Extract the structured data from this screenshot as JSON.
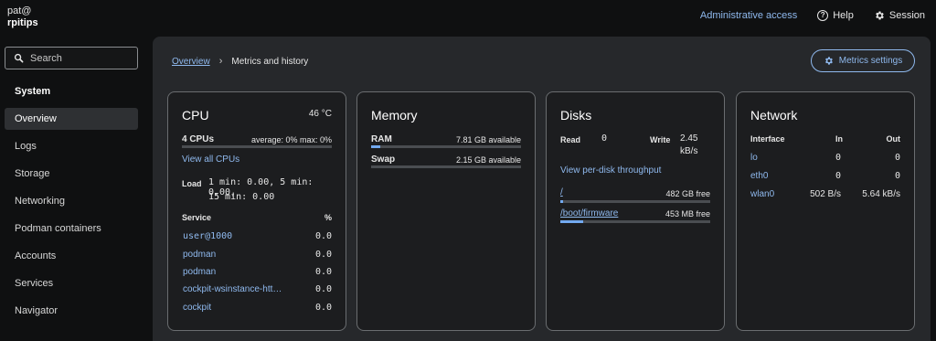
{
  "host": {
    "user": "pat@",
    "name": "rpitips"
  },
  "topnav": {
    "admin": "Administrative access",
    "help": "Help",
    "session": "Session"
  },
  "sidebar": {
    "search_placeholder": "Search",
    "section": "System",
    "items": [
      {
        "label": "Overview",
        "active": true
      },
      {
        "label": "Logs"
      },
      {
        "label": "Storage"
      },
      {
        "label": "Networking"
      },
      {
        "label": "Podman containers"
      },
      {
        "label": "Accounts"
      },
      {
        "label": "Services"
      },
      {
        "label": "Navigator"
      }
    ]
  },
  "breadcrumb": {
    "parent": "Overview",
    "separator": "›",
    "current": "Metrics and history"
  },
  "metrics_settings": "Metrics settings",
  "cpu": {
    "title": "CPU",
    "temp": "46 °C",
    "cores": "4 CPUs",
    "average": "average: 0% max: 0%",
    "usage_fraction": 0.0,
    "view_all": "View all CPUs",
    "load_label": "Load",
    "load_line1": "1 min: 0.00, 5 min: 0.00,",
    "load_line2": "15 min: 0.00",
    "service_header": "Service",
    "percent_header": "%",
    "services": [
      {
        "name": "user@1000",
        "value": "0.0"
      },
      {
        "name": "podman",
        "value": "0.0"
      },
      {
        "name": "podman",
        "value": "0.0"
      },
      {
        "name": "cockpit-wsinstance-htt…",
        "value": "0.0"
      },
      {
        "name": "cockpit",
        "value": "0.0"
      }
    ]
  },
  "memory": {
    "title": "Memory",
    "ram_label": "RAM",
    "ram_available": "7.81 GB available",
    "ram_fraction": 0.06,
    "swap_label": "Swap",
    "swap_available": "2.15 GB available",
    "swap_fraction": 0.0
  },
  "disks": {
    "title": "Disks",
    "read_label": "Read",
    "read_value": "0",
    "write_label": "Write",
    "write_value": "2.45",
    "write_unit": "kB/s",
    "view_per_disk": "View per-disk throughput",
    "mounts": [
      {
        "path": "/",
        "free": "482 GB free",
        "fraction": 0.02
      },
      {
        "path": "/boot/firmware",
        "free": "453 MB free",
        "fraction": 0.15
      }
    ]
  },
  "network": {
    "title": "Network",
    "headers": {
      "interface": "Interface",
      "in": "In",
      "out": "Out"
    },
    "rows": [
      {
        "iface": "lo",
        "in": "0",
        "out": "0"
      },
      {
        "iface": "eth0",
        "in": "0",
        "out": "0"
      },
      {
        "iface": "wlan0",
        "in": "502 B/s",
        "out": "5.64 kB/s"
      }
    ]
  },
  "colors": {
    "accent": "#73aaf0",
    "link": "#8fb9ee",
    "panel": "#26282b",
    "card": "#1c1d1f"
  }
}
